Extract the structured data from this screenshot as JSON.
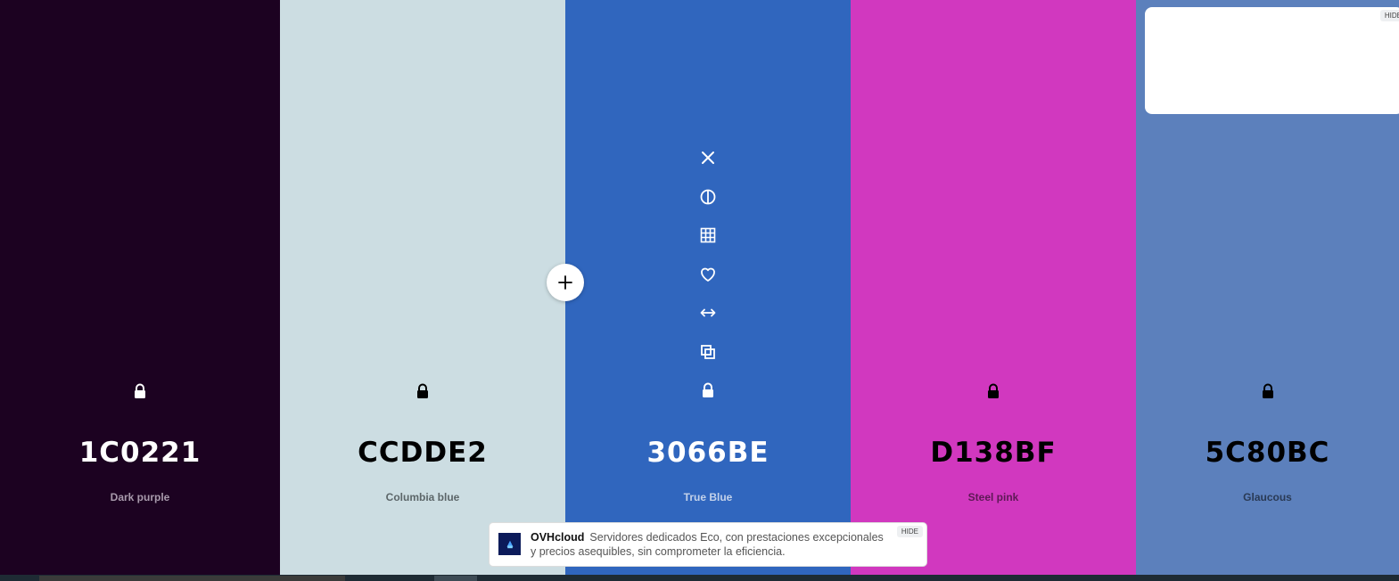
{
  "palette": {
    "colors": [
      {
        "hex": "1C0221",
        "name": "Dark purple",
        "bg": "#1c0221",
        "text_color": "#ffffff",
        "name_color": "#a89aac",
        "icon_color": "#ffffff"
      },
      {
        "hex": "CCDDE2",
        "name": "Columbia blue",
        "bg": "#ccdde2",
        "text_color": "#000000",
        "name_color": "#5c6669",
        "icon_color": "#000000"
      },
      {
        "hex": "3066BE",
        "name": "True Blue",
        "bg": "#3066be",
        "text_color": "#ffffff",
        "name_color": "#c3d2ea",
        "icon_color": "#ffffff"
      },
      {
        "hex": "D138BF",
        "name": "Steel pink",
        "bg": "#d138bf",
        "text_color": "#000000",
        "name_color": "#5e1956",
        "icon_color": "#000000"
      },
      {
        "hex": "5C80BC",
        "name": "Glaucous",
        "bg": "#5c80bc",
        "text_color": "#000000",
        "name_color": "#2a3a55",
        "icon_color": "#000000"
      }
    ],
    "active_tools": [
      "close-icon",
      "contrast-icon",
      "grid-icon",
      "heart-icon",
      "swap-icon",
      "copy-icon",
      "lock-icon"
    ],
    "add_button_icon": "plus-icon"
  },
  "ads": {
    "top_hide_label": "HIDE",
    "bottom": {
      "brand": "OVHcloud",
      "text": "Servidores dedicados Eco, con prestaciones excepcionales y precios asequibles, sin comprometer la eficiencia.",
      "hide_label": "HIDE"
    }
  }
}
